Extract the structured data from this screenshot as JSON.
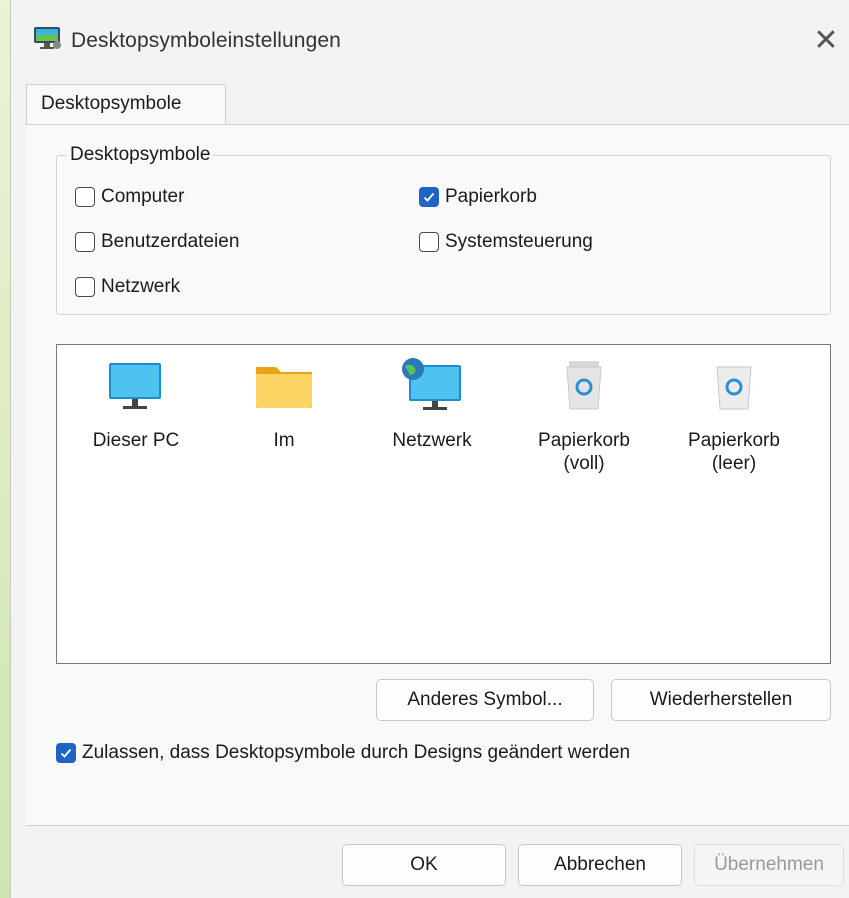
{
  "window": {
    "title": "Desktopsymboleinstellungen",
    "close_glyph": "✕"
  },
  "tab": {
    "label": "Desktopsymbole"
  },
  "group": {
    "legend": "Desktopsymbole",
    "items": [
      {
        "label": "Computer",
        "checked": false
      },
      {
        "label": "Papierkorb",
        "checked": true
      },
      {
        "label": "Benutzerdateien",
        "checked": false
      },
      {
        "label": "Systemsteuerung",
        "checked": false
      },
      {
        "label": "Netzwerk",
        "checked": false
      }
    ]
  },
  "icons": [
    {
      "label": "Dieser PC",
      "icon": "monitor-icon"
    },
    {
      "label": "Im",
      "icon": "folder-icon"
    },
    {
      "label": "Netzwerk",
      "icon": "network-icon"
    },
    {
      "label": "Papierkorb\n(voll)",
      "icon": "recycle-bin-full-icon"
    },
    {
      "label": "Papierkorb\n(leer)",
      "icon": "recycle-bin-empty-icon"
    }
  ],
  "buttons": {
    "change_icon": "Anderes Symbol...",
    "restore": "Wiederherstellen",
    "ok": "OK",
    "cancel": "Abbrechen",
    "apply": "Übernehmen"
  },
  "allow_themes": {
    "label": "Zulassen, dass Desktopsymbole durch Designs geändert werden",
    "checked": true
  },
  "colors": {
    "accent": "#1f63c4"
  }
}
